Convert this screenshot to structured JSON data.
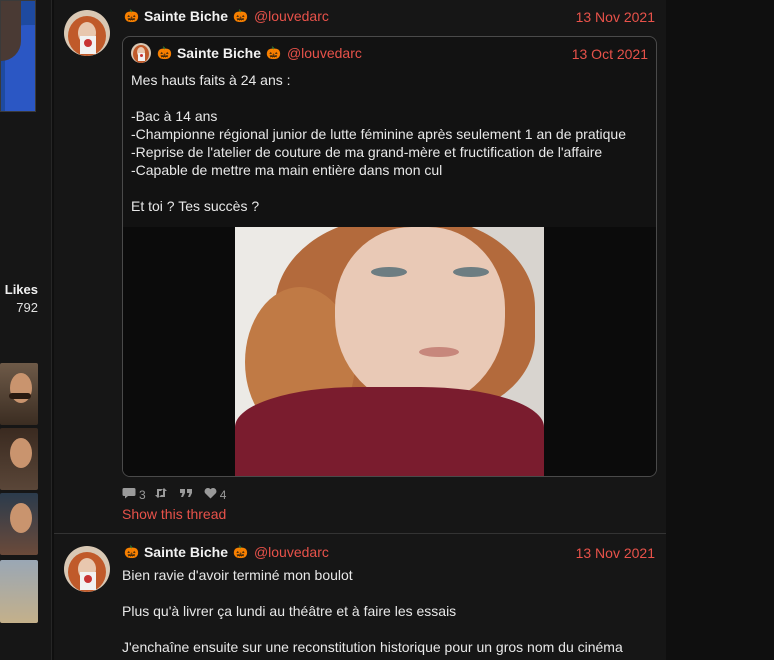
{
  "sidebar": {
    "likes_label": "Likes",
    "likes_value": "792"
  },
  "tweets": [
    {
      "author": {
        "display_name": "Sainte Biche",
        "handle": "@louvedarc",
        "emoji": "🎃"
      },
      "date": "13 Nov 2021",
      "quoted": {
        "author": {
          "display_name": "Sainte Biche",
          "handle": "@louvedarc",
          "emoji": "🎃"
        },
        "date": "13 Oct 2021",
        "lines": [
          "Mes hauts faits à 24 ans :",
          "",
          "-Bac à 14 ans",
          "-Championne régional junior de lutte féminine après seulement 1 an de pratique",
          "-Reprise de l'atelier de couture de ma grand-mère et fructification de l'affaire",
          "-Capable de mettre ma main entière dans mon cul",
          "",
          "Et toi ? Tes succès ?"
        ]
      },
      "stats": {
        "replies": "3",
        "retweets": "",
        "quotes": "",
        "likes": "4"
      },
      "show_thread": "Show this thread"
    },
    {
      "author": {
        "display_name": "Sainte Biche",
        "handle": "@louvedarc",
        "emoji": "🎃"
      },
      "date": "13 Nov 2021",
      "lines": [
        "Bien ravie d'avoir terminé mon boulot",
        "",
        "Plus qu'à livrer ça lundi au théâtre et à faire les essais",
        "",
        "J'enchaîne ensuite sur une reconstitution historique pour un gros nom du cinéma"
      ]
    }
  ],
  "icons": {
    "reply": "speech-bubble-icon",
    "retweet": "retweet-icon",
    "quote": "quote-icon",
    "like": "heart-icon"
  },
  "colors": {
    "accent": "#e8524a",
    "background": "#161616",
    "text": "#e8e8e8",
    "muted": "#9a9a9a"
  }
}
